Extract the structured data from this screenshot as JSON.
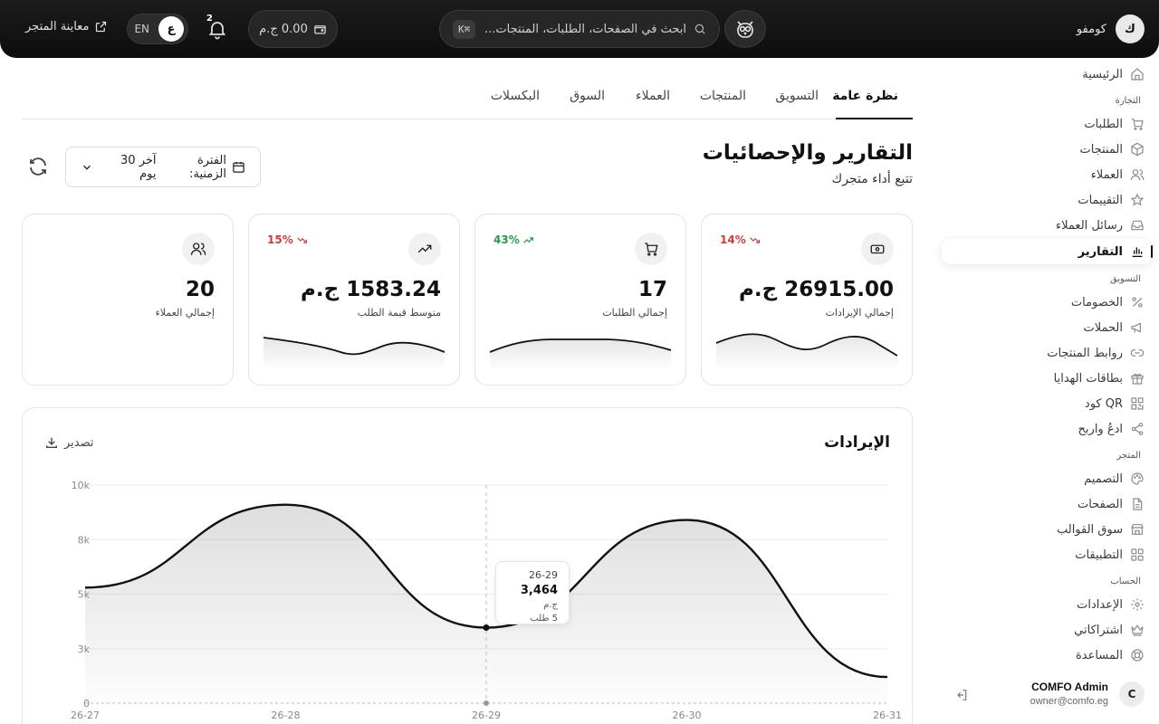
{
  "topbar": {
    "brand_initial": "ك",
    "brand_name": "كومفو",
    "search_placeholder": "ابحث في الصفحات، الطلبات، المنتجات...",
    "search_shortcut": "⌘K",
    "wallet_balance": "0.00 ج.م",
    "notification_count": "2",
    "lang_ar": "ع",
    "lang_en": "EN",
    "preview_store": "معاينة المتجر"
  },
  "sidebar": {
    "home": "الرئيسية",
    "section_commerce": "التجارة",
    "orders": "الطلبات",
    "products": "المنتجات",
    "customers": "العملاء",
    "reviews": "التقييمات",
    "customer_messages": "رسائل العملاء",
    "reports": "التقارير",
    "section_marketing": "التسويق",
    "discounts": "الخصومات",
    "campaigns": "الحملات",
    "product_links": "روابط المنتجات",
    "gift_cards": "بطاقات الهدايا",
    "qr_code": "QR كود",
    "refer_earn": "ادعُ واربح",
    "section_store": "المتجر",
    "design": "التصميم",
    "pages": "الصفحات",
    "templates_market": "سوق القوالب",
    "apps": "التطبيقات",
    "section_account": "الحساب",
    "settings": "الإعدادات",
    "subscriptions": "اشتراكاتي",
    "help": "المساعدة",
    "user_initial": "C",
    "user_name": "COMFO Admin",
    "user_email": "owner@comfo.eg"
  },
  "tabs": [
    "نظرة عامة",
    "التسويق",
    "المنتجات",
    "العملاء",
    "السوق",
    "البكسلات"
  ],
  "header": {
    "title": "التقارير والإحصائيات",
    "subtitle": "تتبع أداء متجرك",
    "period_label": "الفترة الزمنية:",
    "period_value": "آخر 30 يوم"
  },
  "stats": [
    {
      "label": "إجمالي الإيرادات",
      "value": "26915.00 ج.م",
      "trend": "14%",
      "direction": "down",
      "icon": "money-icon"
    },
    {
      "label": "إجمالي الطلبات",
      "value": "17",
      "trend": "43%",
      "direction": "up",
      "icon": "cart-icon"
    },
    {
      "label": "متوسط قيمة الطلب",
      "value": "1583.24 ج.م",
      "trend": "15%",
      "direction": "down",
      "icon": "trending-up-icon"
    },
    {
      "label": "إجمالي العملاء",
      "value": "20",
      "trend": "",
      "direction": "",
      "icon": "users-icon"
    }
  ],
  "revenue_card": {
    "title": "الإيرادات",
    "export_label": "تصدير",
    "tooltip": {
      "date": "26-29",
      "value": "3,464",
      "currency": "ج.م",
      "orders": "5 طلب"
    }
  },
  "chart_data": {
    "type": "area",
    "x": [
      "26-27",
      "26-28",
      "26-29",
      "26-30",
      "26-31"
    ],
    "values": [
      5300,
      9100,
      3464,
      8400,
      1200
    ],
    "yticks": [
      "0",
      "3k",
      "5k",
      "8k",
      "10k"
    ],
    "ylim": [
      0,
      10000
    ],
    "grid": true,
    "title": "الإيرادات",
    "color": "#111111"
  },
  "colors": {
    "accent": "#111111",
    "trend_up": "#1f9d4c",
    "trend_down": "#d23a3a"
  }
}
